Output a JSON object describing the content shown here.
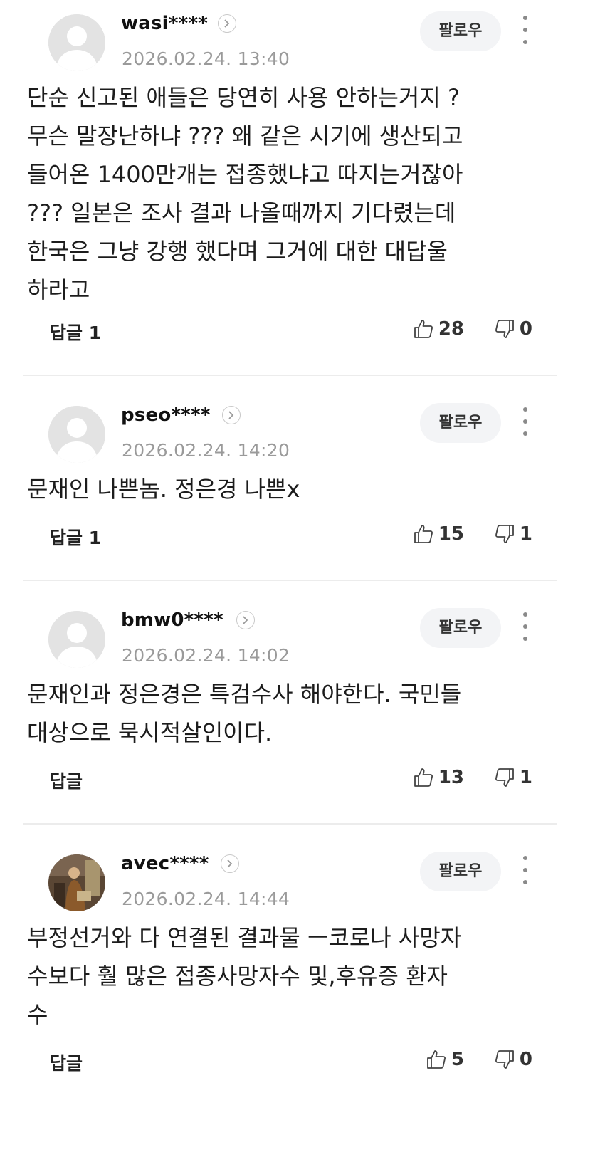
{
  "comments": [
    {
      "username": "wasi****",
      "timestamp": "2026.02.24. 13:40",
      "follow_label": "팔로우",
      "body": "단순 신고된 애들은 당연히 사용 안하는거지 ?\n무슨 말장난하냐 ??? 왜 같은 시기에 생산되고\n들어온 1400만개는 접종했냐고 따지는거잖아\n??? 일본은 조사 결과 나올때까지 기다렸는데\n한국은 그냥 강행 했다며 그거에 대한 대답울\n하라고",
      "reply_label": "답글 1",
      "likes": "28",
      "dislikes": "0",
      "avatar": "default-avatar-icon"
    },
    {
      "username": "pseo****",
      "timestamp": "2026.02.24. 14:20",
      "follow_label": "팔로우",
      "body": "문재인 나쁜놈. 정은경 나쁜x",
      "reply_label": "답글 1",
      "likes": "15",
      "dislikes": "1",
      "avatar": "default-avatar-icon"
    },
    {
      "username": "bmw0****",
      "timestamp": "2026.02.24. 14:02",
      "follow_label": "팔로우",
      "body": "문재인과 정은경은 특검수사 해야한다. 국민들\n대상으로 묵시적살인이다.",
      "reply_label": "답글",
      "likes": "13",
      "dislikes": "1",
      "avatar": "default-avatar-icon"
    },
    {
      "username": "avec****",
      "timestamp": "2026.02.24. 14:44",
      "follow_label": "팔로우",
      "body": "부정선거와 다 연결된 결과물 ㅡ코로나 사망자\n수보다 훨 많은 접종사망자수 및,후유증 환자\n수",
      "reply_label": "답글",
      "likes": "5",
      "dislikes": "0",
      "avatar": "photo-avatar"
    }
  ],
  "colors": {
    "text": "#1c1c1c",
    "meta": "#9a9a9a",
    "follow_bg": "#f3f4f6",
    "divider": "#ececec"
  }
}
